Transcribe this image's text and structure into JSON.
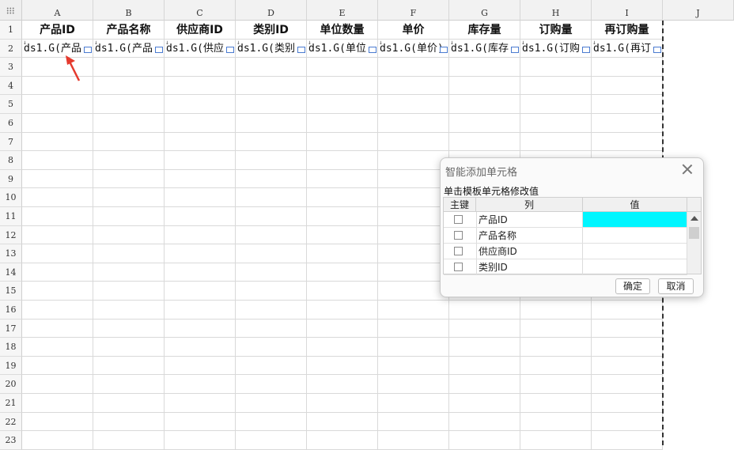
{
  "sheet": {
    "columns": [
      "A",
      "B",
      "C",
      "D",
      "E",
      "F",
      "G",
      "H",
      "I",
      "J"
    ],
    "rows": [
      "1",
      "2",
      "3",
      "4",
      "5",
      "6",
      "7",
      "8",
      "9",
      "10",
      "11",
      "12",
      "13",
      "14",
      "15",
      "16",
      "17",
      "18",
      "19",
      "20",
      "21",
      "22",
      "23"
    ],
    "headers": [
      "产品ID",
      "产品名称",
      "供应商ID",
      "类别ID",
      "单位数量",
      "单价",
      "库存量",
      "订购量",
      "再订购量"
    ],
    "row2": [
      "ds1.G(产品",
      "ds1.G(产品",
      "ds1.G(供应",
      "ds1.G(类别",
      "ds1.G(单位",
      "ds1.G(单价)",
      "ds1.G(库存",
      "ds1.G(订购",
      "ds1.G(再订"
    ],
    "tick_glyph": "↓"
  },
  "dialog": {
    "title": "智能添加单元格",
    "hint": "单击模板单元格修改值",
    "col_key": "主键",
    "col_column": "列",
    "col_value": "值",
    "rows": [
      {
        "column": "产品ID",
        "checked": false,
        "value": "",
        "active": true
      },
      {
        "column": "产品名称",
        "checked": false,
        "value": "",
        "active": false
      },
      {
        "column": "供应商ID",
        "checked": false,
        "value": "",
        "active": false
      },
      {
        "column": "类别ID",
        "checked": false,
        "value": "",
        "active": false
      }
    ],
    "ok_label": "确定",
    "cancel_label": "取消"
  },
  "colors": {
    "active_value": "#00f6ff",
    "arrow": "#e53a2e",
    "cell_selector": "#4a7bd0"
  }
}
